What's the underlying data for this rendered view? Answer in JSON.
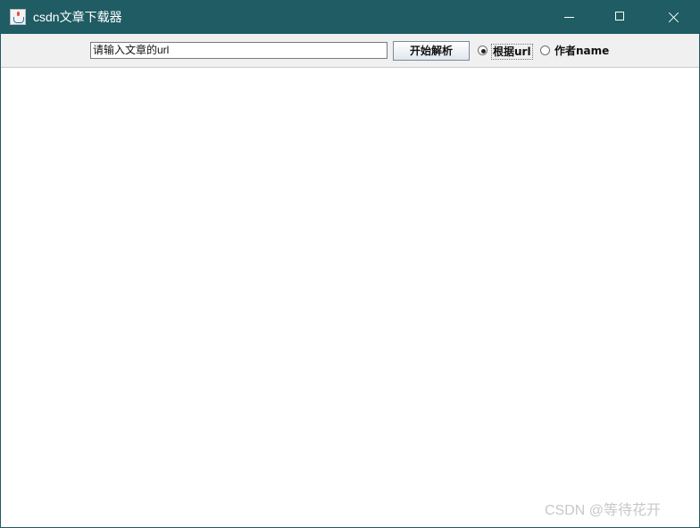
{
  "window": {
    "title": "csdn文章下载器"
  },
  "toolbar": {
    "url_input_value": "请输入文章的url",
    "parse_button_label": "开始解析",
    "radio_by_url_label": "根据url",
    "radio_by_author_label": "作者name",
    "selected_mode": "根据url"
  },
  "watermark": {
    "text": "CSDN @等待花开"
  },
  "colors": {
    "titlebar": "#1f5c63",
    "toolbar": "#f0f0f0"
  },
  "icons": [
    "java-app-icon",
    "minimize-icon",
    "maximize-icon",
    "close-icon"
  ]
}
